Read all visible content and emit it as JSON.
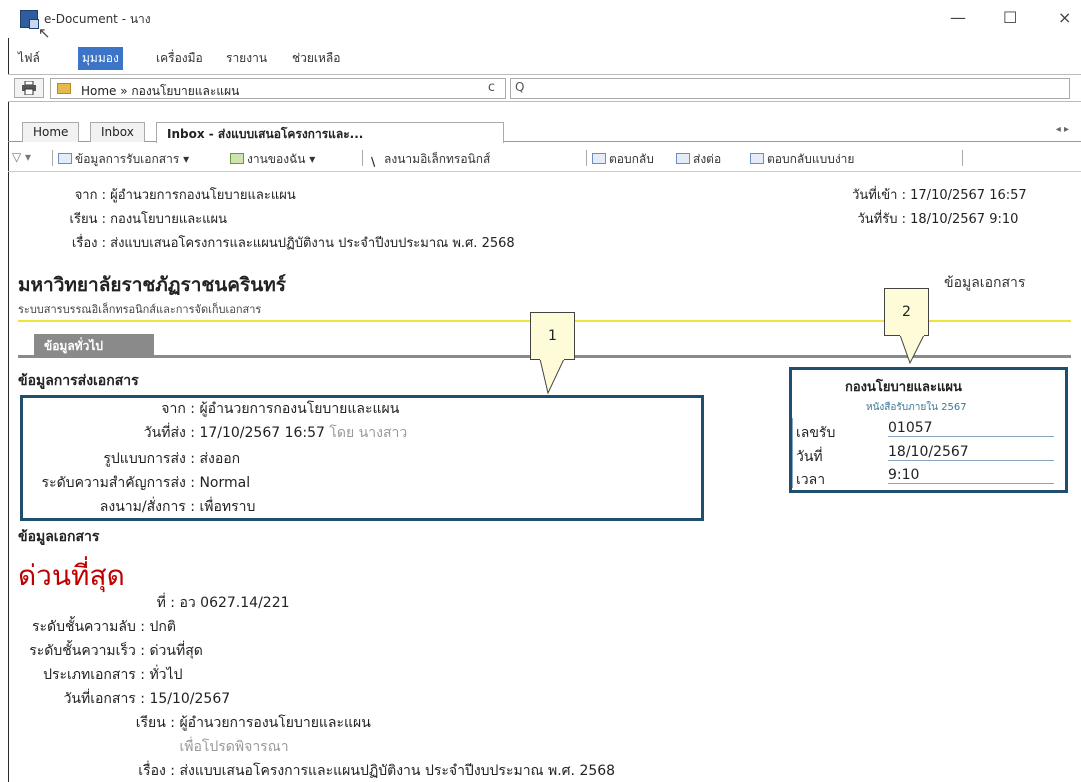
{
  "window": {
    "title": "e-Document - นาง",
    "minimize_glyph": "—",
    "maximize_glyph": "☐",
    "close_glyph": "×",
    "cursor_glyph": "↖"
  },
  "menu": {
    "items": [
      "ไฟล์",
      "มุมมอง",
      "เครื่องมือ",
      "รายงาน",
      "ช่วยเหลือ"
    ],
    "active_index": 1
  },
  "address": {
    "path": "Home » กองนโยบายและแผน",
    "print_icon": "printer-icon",
    "refresh_glyph": "c",
    "search_glyph": "Q",
    "search_placeholder": ""
  },
  "tabs": {
    "items": [
      "Home",
      "Inbox",
      "Inbox - ส่งแบบเสนอโครงการและ..."
    ],
    "active_index": 2,
    "scroll_glyph": "◂ ▸"
  },
  "toolbar": {
    "filter": "▽ ▾",
    "items": [
      "ข้อมูลการรับเอกสาร ▾",
      "งานของฉัน ▾",
      "ลงนามอิเล็กทรอนิกส์",
      "ตอบกลับ",
      "ส่งต่อ",
      "ตอบกลับแบบง่าย"
    ]
  },
  "message": {
    "from_label": "จาก :",
    "from_value": "ผู้อำนวยการกองนโยบายและแผน",
    "to_label": "เรียน :",
    "to_value": "กองนโยบายและแผน",
    "subject_label": "เรื่อง :",
    "subject_value": "ส่งแบบเสนอโครงการและแผนปฏิบัติงาน ประจำปีงบประมาณ พ.ศ. 2568",
    "received_in_label": "วันที่เข้า :",
    "received_in_value": "17/10/2567 16:57",
    "received_label": "วันที่รับ :",
    "received_value": "18/10/2567 9:10"
  },
  "document": {
    "university": "มหาวิทยาลัยราชภัฏราชนครินทร์",
    "doc_info_link": "ข้อมูลเอกสาร",
    "system_subtitle": "ระบบสารบรรณอิเล็กทรอนิกส์และการจัดเก็บเอกสาร",
    "section_tab": "ข้อมูลทั่วไป"
  },
  "sending": {
    "heading": "ข้อมูลการส่งเอกสาร",
    "rows": [
      {
        "k": "จาก :",
        "v": "ผู้อำนวยการกองนโยบายและแผน",
        "extra": ""
      },
      {
        "k": "วันที่ส่ง :",
        "v": "17/10/2567 16:57",
        "extra": "โดย นางสาว"
      },
      {
        "k": "รูปแบบการส่ง :",
        "v": "ส่งออก",
        "extra": ""
      },
      {
        "k": "ระดับความสำคัญการส่ง :",
        "v": "Normal",
        "extra": ""
      },
      {
        "k": "ลงนาม/สั่งการ :",
        "v": "เพื่อทราบ",
        "extra": ""
      }
    ]
  },
  "doc_details": {
    "heading": "ข้อมูลเอกสาร",
    "urgency": "ด่วนที่สุด",
    "rows": [
      {
        "k": "ที่ :",
        "v": "อว 0627.14/221"
      },
      {
        "k": "ระดับชั้นความลับ :",
        "v": "ปกติ"
      },
      {
        "k": "ระดับชั้นความเร็ว :",
        "v": "ด่วนที่สุด"
      },
      {
        "k": "ประเภทเอกสาร :",
        "v": "ทั่วไป"
      },
      {
        "k": "วันที่เอกสาร :",
        "v": "15/10/2567"
      },
      {
        "k": "เรียน :",
        "v": "ผู้อำนวยการองนโยบายและแผน"
      },
      {
        "k": "",
        "v": "เพื่อโปรดพิจารณา"
      },
      {
        "k": "เรื่อง :",
        "v": "ส่งแบบเสนอโครงการและแผนปฏิบัติงาน ประจำปีงบประมาณ พ.ศ. 2568"
      }
    ]
  },
  "stamp": {
    "title": "กองนโยบายและแผน",
    "subtitle": "หนังสือรับภายใน 2567",
    "rows": [
      {
        "k": "เลขรับ",
        "v": "01057"
      },
      {
        "k": "วันที่",
        "v": "18/10/2567"
      },
      {
        "k": "เวลา",
        "v": "9:10"
      }
    ]
  },
  "callouts": [
    "1",
    "2"
  ],
  "colors": {
    "menu_active": "#3c74c8",
    "urgent": "#c00000",
    "highlight_border": "#1f4e6e",
    "callout_fill": "#fdfbd8",
    "yellow_rule": "#f2e23c"
  }
}
